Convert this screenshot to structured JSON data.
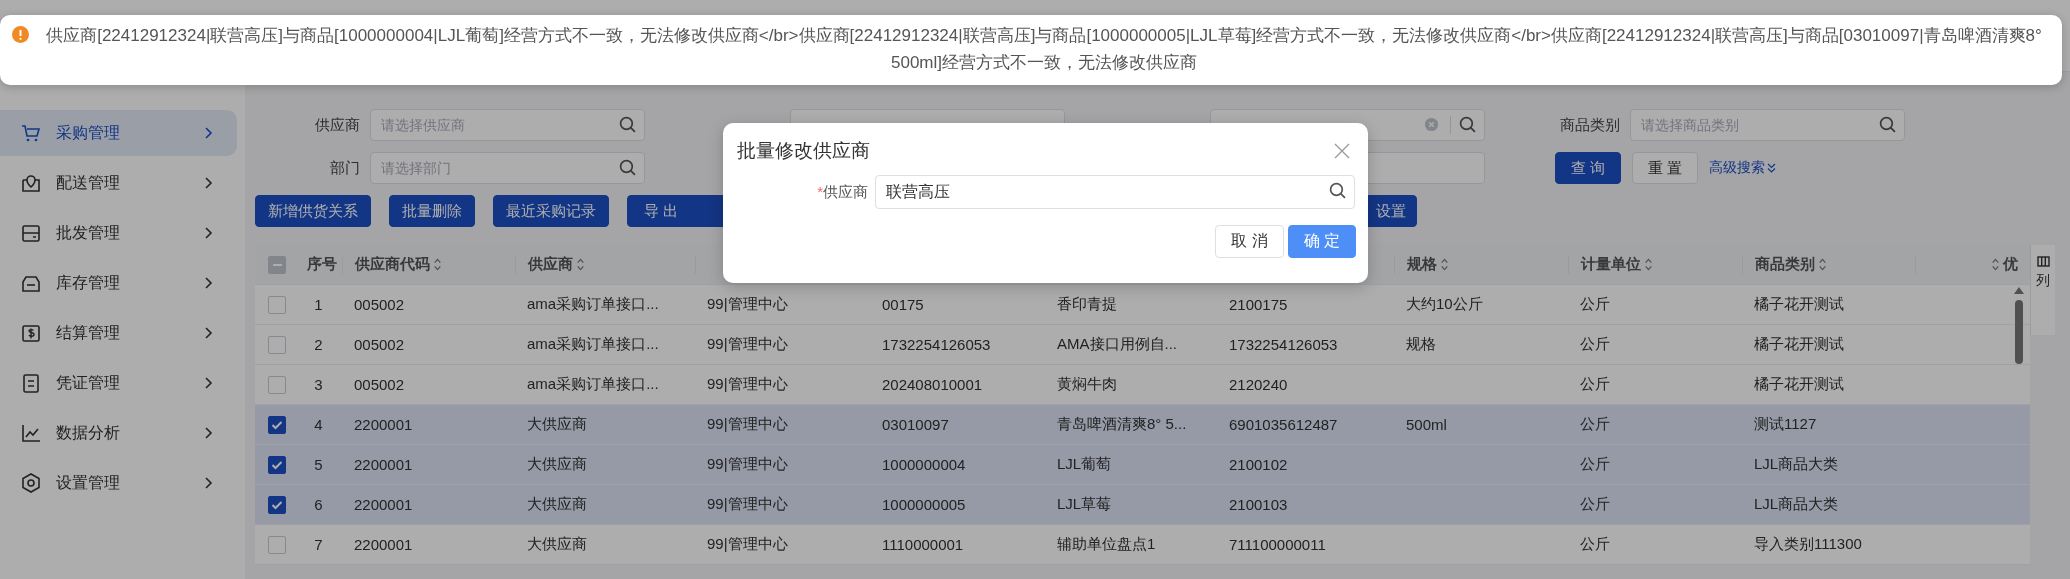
{
  "toast": {
    "lines": [
      "供应商[22412912324|联营高压]与商品[1000000004|LJL葡萄]经营方式不一致，无法修改供应商</br>供应商[22412912324|联营高压]与商品[1000000005|LJL草莓]经营方式不一致，无法修改供应商</br>供应商[22412912324|联营高压]与商品[03010097|青岛啤酒清爽8°",
      "500ml]经营方式不一致，无法修改供应商"
    ]
  },
  "sidebar": {
    "items": [
      {
        "label": "采购管理",
        "selected": true
      },
      {
        "label": "配送管理",
        "selected": false
      },
      {
        "label": "批发管理",
        "selected": false
      },
      {
        "label": "库存管理",
        "selected": false
      },
      {
        "label": "结算管理",
        "selected": false
      },
      {
        "label": "凭证管理",
        "selected": false
      },
      {
        "label": "数据分析",
        "selected": false
      },
      {
        "label": "设置管理",
        "selected": false
      }
    ]
  },
  "filters": {
    "row_1": [
      {
        "kind": "search",
        "label": "供应商",
        "placeholder": "请选择供应商"
      },
      {
        "kind": "text"
      },
      {
        "kind": "clearable"
      },
      {
        "kind": "search",
        "label": "商品类别",
        "placeholder": "请选择商品类别"
      }
    ],
    "row_2": [
      {
        "kind": "search",
        "label": "部门",
        "placeholder": "请选择部门"
      },
      {
        "kind": "text"
      }
    ],
    "actions": {
      "query": "查 询",
      "reset": "重 置",
      "advanced": "高级搜索"
    }
  },
  "toolbar": {
    "buttons": [
      {
        "label": "新增供货关系"
      },
      {
        "label": "批量删除"
      },
      {
        "label": "最近采购记录"
      },
      {
        "label": "导 出"
      }
    ],
    "tail_button": "设置"
  },
  "table": {
    "header_checkbox": {
      "indeterminate": true
    },
    "columns": [
      {
        "label": "序号",
        "sortable": false
      },
      {
        "label": "供应商代码",
        "sortable": true
      },
      {
        "label": "供应商",
        "sortable": true
      },
      null,
      null,
      null,
      null,
      {
        "label": "规格",
        "sortable": true
      },
      {
        "label": "计量单位",
        "sortable": true
      },
      {
        "label": "商品类别",
        "sortable": true
      },
      {
        "label": "优",
        "sortable": true
      }
    ],
    "rows": [
      {
        "selected": false,
        "cells": [
          "1",
          "005002",
          "ama采购订单接口...",
          "99|管理中心",
          "00175",
          "香印青提",
          "2100175",
          "大约10公斤",
          "公斤",
          "橘子花开测试"
        ]
      },
      {
        "selected": false,
        "cells": [
          "2",
          "005002",
          "ama采购订单接口...",
          "99|管理中心",
          "1732254126053",
          "AMA接口用例自...",
          "1732254126053",
          "规格",
          "公斤",
          "橘子花开测试"
        ]
      },
      {
        "selected": false,
        "cells": [
          "3",
          "005002",
          "ama采购订单接口...",
          "99|管理中心",
          "202408010001",
          "黄焖牛肉",
          "2120240",
          null,
          "公斤",
          "橘子花开测试"
        ]
      },
      {
        "selected": true,
        "cells": [
          "4",
          "2200001",
          "大供应商",
          "99|管理中心",
          "03010097",
          "青岛啤酒清爽8° 5...",
          "6901035612487",
          "500ml",
          "公斤",
          "测试1127"
        ]
      },
      {
        "selected": true,
        "cells": [
          "5",
          "2200001",
          "大供应商",
          "99|管理中心",
          "1000000004",
          "LJL葡萄",
          "2100102",
          null,
          "公斤",
          "LJL商品大类"
        ]
      },
      {
        "selected": true,
        "cells": [
          "6",
          "2200001",
          "大供应商",
          "99|管理中心",
          "1000000005",
          "LJL草莓",
          "2100103",
          null,
          "公斤",
          "LJL商品大类"
        ]
      },
      {
        "selected": false,
        "cells": [
          "7",
          "2200001",
          "大供应商",
          "99|管理中心",
          "1110000001",
          "辅助单位盘点1",
          "711100000011",
          null,
          "公斤",
          "导入类别111300"
        ]
      }
    ],
    "column_settings": "列"
  },
  "dialog": {
    "title": "批量修改供应商",
    "field": {
      "required_mark": "*",
      "label": "供应商",
      "value": "联营高压"
    },
    "buttons": [
      {
        "label": "取 消",
        "primary": false
      },
      {
        "label": "确 定",
        "primary": true
      }
    ]
  }
}
